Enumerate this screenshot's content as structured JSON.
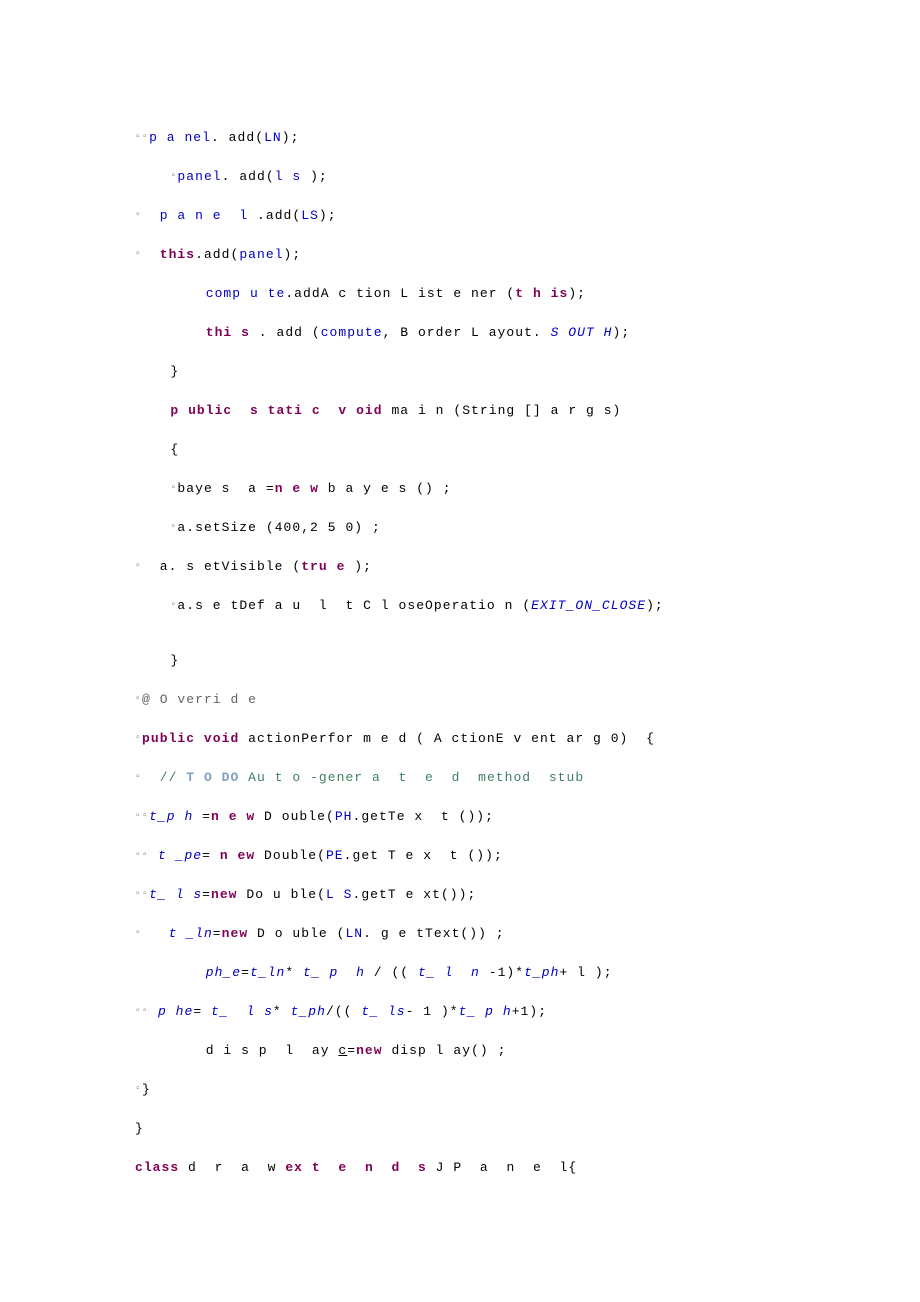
{
  "marker": "▫",
  "lines": {
    "l1_p1": "p",
    "l1_p2": "a",
    "l1_p3": "nel",
    "l1_t1": ". add(",
    "l1_f1": "LN",
    "l1_t2": ");",
    "l2_m1": "  ",
    "l2_f1": "panel",
    "l2_t1": ". add(",
    "l2_f2": "l",
    "l2_f3": "s",
    "l2_t2": ");",
    "l3_t1": "  ",
    "l3_f1": "p",
    "l3_f2": "a",
    "l3_f3": "n",
    "l3_f4": "e",
    "l3_f5": "l",
    "l3_t2": ".add(",
    "l3_f6": "LS",
    "l3_t3": ");",
    "l4_t1": "  ",
    "l4_k1": "this",
    "l4_t2": ".add(",
    "l4_f1": "panel",
    "l4_t3": ");",
    "l5_t1": "        ",
    "l5_f1": "comp",
    "l5_f2": "u",
    "l5_f3": "te",
    "l5_t2": ".addA",
    "l5_t3": "c",
    "l5_t4": "tion",
    "l5_t5": "L",
    "l5_t6": "ist",
    "l5_t7": "e",
    "l5_t8": "ner",
    "l5_t9": "(",
    "l5_k1": "t",
    "l5_k2": "h",
    "l5_k3": "is",
    "l5_t10": ");",
    "l6_t1": "        ",
    "l6_k1": "thi",
    "l6_k2": "s",
    "l6_t2": ". add (",
    "l6_f1": "compute",
    "l6_t3": ", B",
    "l6_t4": "order",
    "l6_t5": "L",
    "l6_t6": "ayout.",
    "l6_i1": "S",
    "l6_i2": "OUT",
    "l6_i3": "H",
    "l6_t7": ");",
    "l7_t1": "    }",
    "l8_t1": "    ",
    "l8_k1": "p",
    "l8_k2": "ublic  s",
    "l8_k3": "tati",
    "l8_k4": "c  v",
    "l8_k5": "oid",
    "l8_t2": " ma",
    "l8_t3": "i",
    "l8_t4": "n",
    "l8_t5": "(String [] a",
    "l8_t6": "r",
    "l8_t7": "g",
    "l8_t8": "s)",
    "l9_t1": "    {",
    "l10_t1": "  ",
    "l10_t2": "baye",
    "l10_t3": "s  a",
    "l10_t4": "=",
    "l10_k1": "n",
    "l10_k2": "e",
    "l10_k3": "w",
    "l10_t5": " b",
    "l10_t6": "a",
    "l10_t7": "y",
    "l10_t8": "e",
    "l10_t9": "s",
    "l10_t10": "()",
    "l10_t11": ";",
    "l11_t1": "  ",
    "l11_t2": "a.setSize",
    "l11_t3": "(400,2",
    "l11_t4": "5",
    "l11_t5": "0)",
    "l11_t6": ";",
    "l12_t1": "  a.",
    "l12_t2": "s",
    "l12_t3": "etVisible",
    "l12_t4": "(",
    "l12_k1": "tru",
    "l12_k2": "e",
    "l12_t5": ");",
    "l13_t1": "  ",
    "l13_t2": "a.s",
    "l13_t3": "e",
    "l13_t4": "tDef",
    "l13_t5": "a",
    "l13_t6": "u",
    "l13_t7": "l",
    "l13_t8": "t",
    "l13_t9": "C",
    "l13_t10": "l",
    "l13_t11": "oseOperatio",
    "l13_t12": "n",
    "l13_t13": "(",
    "l13_i1": "EXIT_ON_CLOSE",
    "l13_t14": ");",
    "l14_t1": "    }",
    "l15_a1": "@",
    "l15_a2": "O",
    "l15_a3": "verri",
    "l15_a4": "d",
    "l15_a5": "e",
    "l16_k1": "public void",
    "l16_t1": " actionPerfor",
    "l16_t2": "m",
    "l16_t3": "e",
    "l16_t4": "d",
    "l16_t5": "(",
    "l16_t6": "A",
    "l16_t7": "ctionE",
    "l16_t8": "v",
    "l16_t9": "ent ar",
    "l16_t10": "g",
    "l16_t11": "0)  {",
    "l17_t1": "  ",
    "l17_c1": "// ",
    "l17_td": "T",
    "l17_td2": "O",
    "l17_td3": "DO",
    "l17_c2": " Au",
    "l17_c3": "t",
    "l17_c4": "o",
    "l17_c5": "-gener",
    "l17_c6": "a",
    "l17_c7": "t",
    "l17_c8": "e",
    "l17_c9": "d  method  stub",
    "l18_i1": "t_p",
    "l18_i2": "h",
    "l18_t1": "=",
    "l18_k1": "n",
    "l18_k2": "e",
    "l18_k3": "w",
    "l18_t2": " D",
    "l18_t3": "ouble(",
    "l18_f1": "PH",
    "l18_t4": ".getTe",
    "l18_t5": "x",
    "l18_t6": "t",
    "l18_t7": "());",
    "l19_i1": "t",
    "l19_i2": "_pe",
    "l19_t1": "=",
    "l19_k1": "n",
    "l19_k2": "ew",
    "l19_t2": " Double(",
    "l19_f1": "PE",
    "l19_t3": ".get",
    "l19_t4": "T",
    "l19_t5": "e",
    "l19_t6": "x",
    "l19_t7": "t",
    "l19_t8": "());",
    "l20_i1": "t_",
    "l20_i2": "l",
    "l20_i3": "s",
    "l20_t1": "=",
    "l20_k1": "new",
    "l20_t2": " Do",
    "l20_t3": "u",
    "l20_t4": "ble(",
    "l20_f1": "L",
    "l20_f2": "S",
    "l20_t5": ".getT",
    "l20_t6": "e",
    "l20_t7": "xt());",
    "l21_t1": "  ",
    "l21_i1": "t",
    "l21_i2": "_ln",
    "l21_t2": "=",
    "l21_k1": "new",
    "l21_t3": " D",
    "l21_t4": "o",
    "l21_t5": "uble",
    "l21_t6": "(",
    "l21_f1": "LN",
    "l21_t7": ". g",
    "l21_t8": "e",
    "l21_t9": "tText())",
    "l21_t10": ";",
    "l22_t1": "        ",
    "l22_i1": "ph_e",
    "l22_t2": "=",
    "l22_i2": "t_ln",
    "l22_t3": "*",
    "l22_i3": "t_",
    "l22_i4": "p",
    "l22_i5": "h",
    "l22_t4": "/",
    "l22_t5": "((",
    "l22_i6": "t_",
    "l22_i7": "l",
    "l22_i8": "n",
    "l22_t6": "-",
    "l22_t7": "1)*",
    "l22_i9": "t_ph",
    "l22_t8": "+",
    "l22_t9": "l",
    "l22_t10": ");",
    "l23_i1": "p",
    "l23_i2": "he",
    "l23_t1": "=",
    "l23_i3": "t_",
    "l23_i4": "l",
    "l23_i5": "s",
    "l23_t2": "*",
    "l23_i6": "t_ph",
    "l23_t3": "/((",
    "l23_i7": "t_",
    "l23_i8": "ls",
    "l23_t4": "-",
    "l23_t5": "1",
    "l23_t6": ")*",
    "l23_i9": "t_",
    "l23_i10": "p",
    "l23_i11": "h",
    "l23_t7": "+",
    "l23_t8": "1);",
    "l24_t1": "        d",
    "l24_t2": "i",
    "l24_t3": "s",
    "l24_t4": "p",
    "l24_t5": "l",
    "l24_t6": "ay ",
    "l24_u1": "c",
    "l24_t7": "=",
    "l24_k1": "new",
    "l24_t8": " disp",
    "l24_t9": "l",
    "l24_t10": "ay()",
    "l24_t11": ";",
    "l25_t1": "}",
    "l26_t1": "}",
    "l27_k1": "class",
    "l27_t1": " d",
    "l27_t2": "r",
    "l27_t3": "a",
    "l27_t4": "w",
    "l27_t5": " ",
    "l27_k2": "ex",
    "l27_k3": "t",
    "l27_k4": "e",
    "l27_k5": "n",
    "l27_k6": "d",
    "l27_k7": "s",
    "l27_t6": " J",
    "l27_t7": "P",
    "l27_t8": "a",
    "l27_t9": "n",
    "l27_t10": "e",
    "l27_t11": "l{"
  }
}
